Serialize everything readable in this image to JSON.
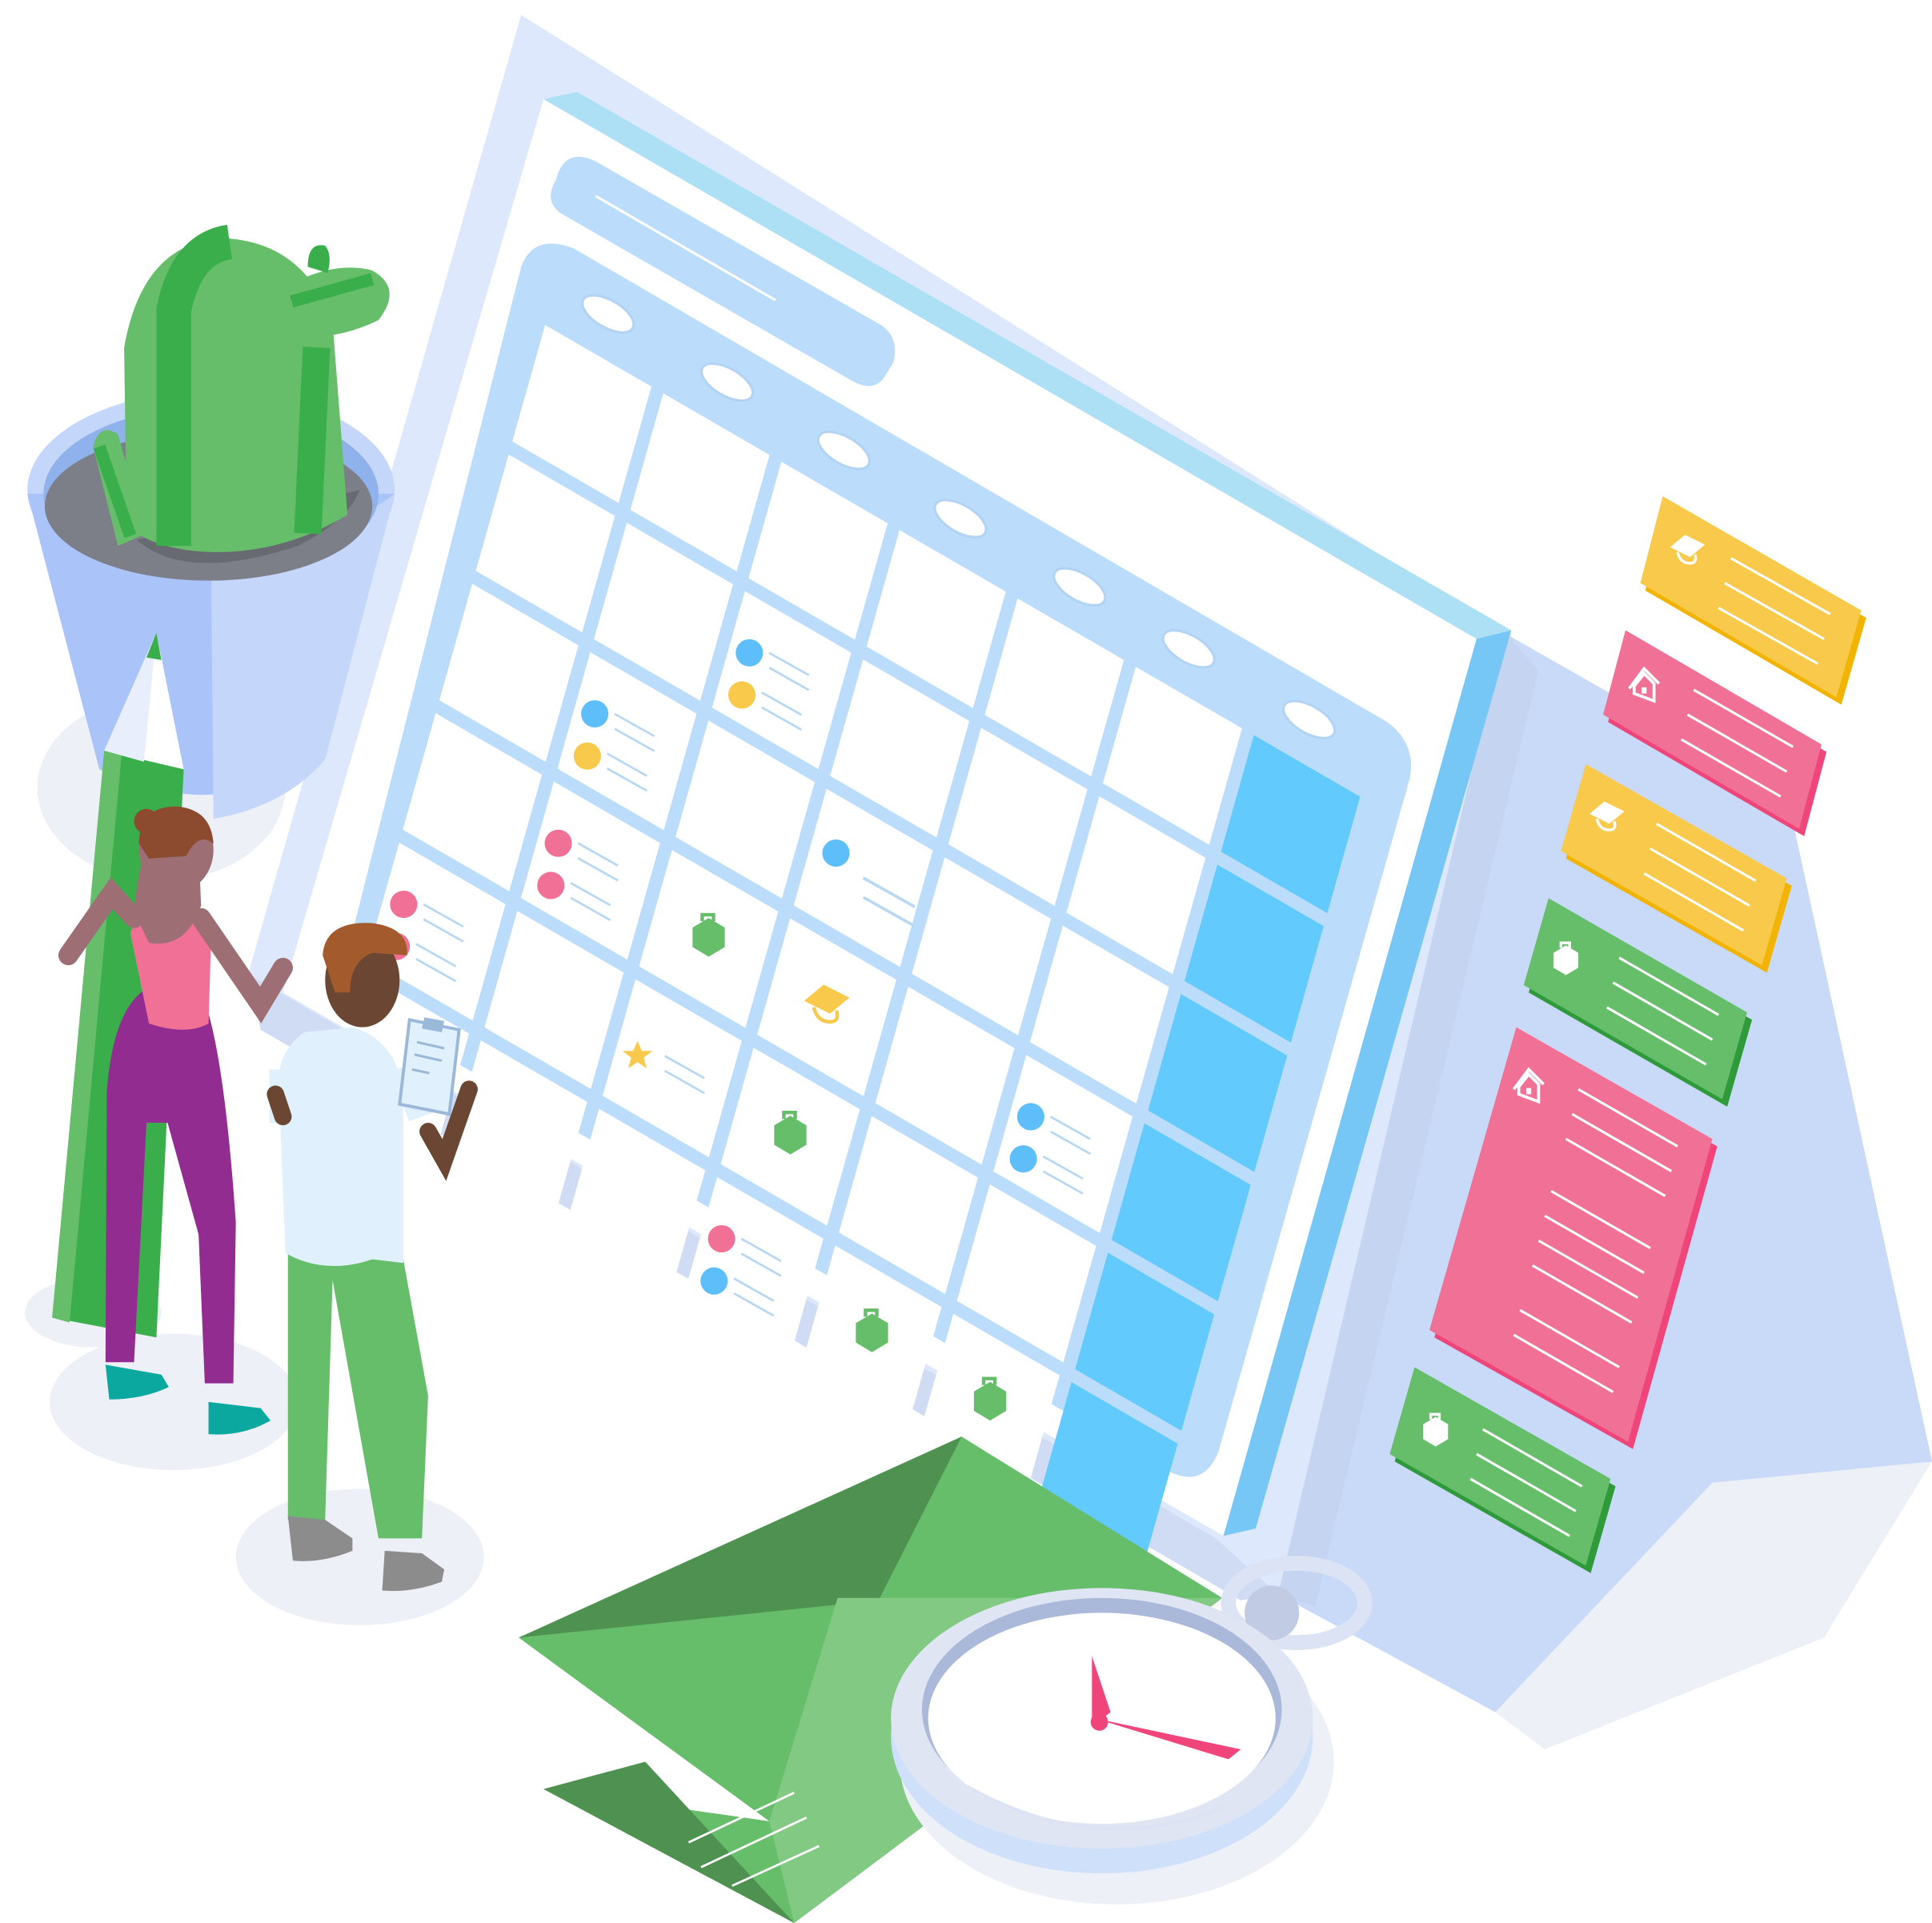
{
  "illustration": {
    "subject": "isometric-calendar-planning",
    "colors": {
      "background": "#ffffff",
      "board_light": "#dde8fd",
      "board_side": "#c9d9f8",
      "board_dark": "#aec6ef",
      "calendar_frame": "#bbdcfb",
      "calendar_cell": "#ffffff",
      "weekend_cell": "#62cafc",
      "accent_blue": "#5ebefa",
      "accent_yellow": "#f8c94a",
      "accent_pink": "#f07195",
      "accent_green": "#66bd6a",
      "accent_green_dark": "#3aae4b",
      "skin": "#875540"
    },
    "calendar": {
      "columns": 7,
      "rows": 6,
      "weekend_column_highlighted": true,
      "event_icons": [
        "dot-pair",
        "briefcase-icon",
        "graduation-cap-icon",
        "star-icon"
      ]
    },
    "side_cards": [
      {
        "color": "yellow",
        "icon": "graduation-cap-icon"
      },
      {
        "color": "pink",
        "icon": "home-icon"
      },
      {
        "color": "yellow",
        "icon": "graduation-cap-icon"
      },
      {
        "color": "green",
        "icon": "briefcase-icon"
      },
      {
        "color": "pink",
        "icon": "home-icon"
      },
      {
        "color": "green",
        "icon": "briefcase-icon"
      }
    ],
    "props": [
      "cactus-pot",
      "pencil",
      "envelope",
      "stopwatch"
    ],
    "people": [
      "woman-pointing",
      "man-with-clipboard"
    ]
  }
}
